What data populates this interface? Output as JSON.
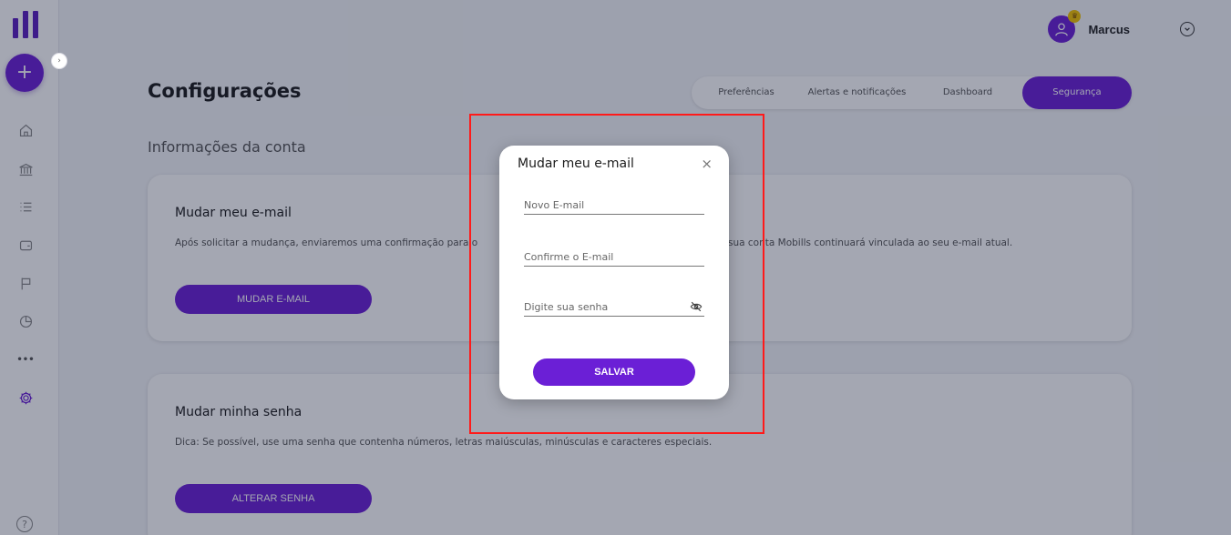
{
  "app": {
    "brand_color": "#6b1fd6",
    "highlight_color": "#ff1a1a"
  },
  "sidebar": {
    "fab_label": "+",
    "expand_label": "›",
    "icons": [
      "home-icon",
      "bank-icon",
      "list-icon",
      "wallet-icon",
      "flag-icon",
      "pie-chart-icon",
      "more-icon",
      "gear-icon",
      "help-icon"
    ],
    "more_label": "•••",
    "help_label": "?"
  },
  "user": {
    "name": "Marcus",
    "badge": "♛"
  },
  "page": {
    "title": "Configurações",
    "section_title": "Informações da conta"
  },
  "tabs": [
    {
      "label": "Preferências",
      "active": false
    },
    {
      "label": "Alertas e notificações",
      "active": false
    },
    {
      "label": "Dashboard",
      "active": false
    },
    {
      "label": "Segurança",
      "active": true
    }
  ],
  "cards": {
    "email": {
      "title": "Mudar meu e-mail",
      "description_left": "Após solicitar a mudança, enviaremos uma confirmação para o",
      "description_right": "sua conta Mobills continuará vinculada ao seu e-mail atual.",
      "button": "MUDAR E-MAIL"
    },
    "password": {
      "title": "Mudar minha senha",
      "description": "Dica: Se possível, use uma senha que contenha números, letras maiúsculas, minúsculas e caracteres especiais.",
      "button": "ALTERAR SENHA"
    }
  },
  "modal": {
    "title": "Mudar meu e-mail",
    "close_label": "×",
    "new_email_placeholder": "Novo E-mail",
    "confirm_email_placeholder": "Confirme o E-mail",
    "password_placeholder": "Digite sua senha",
    "save_label": "SALVAR"
  }
}
